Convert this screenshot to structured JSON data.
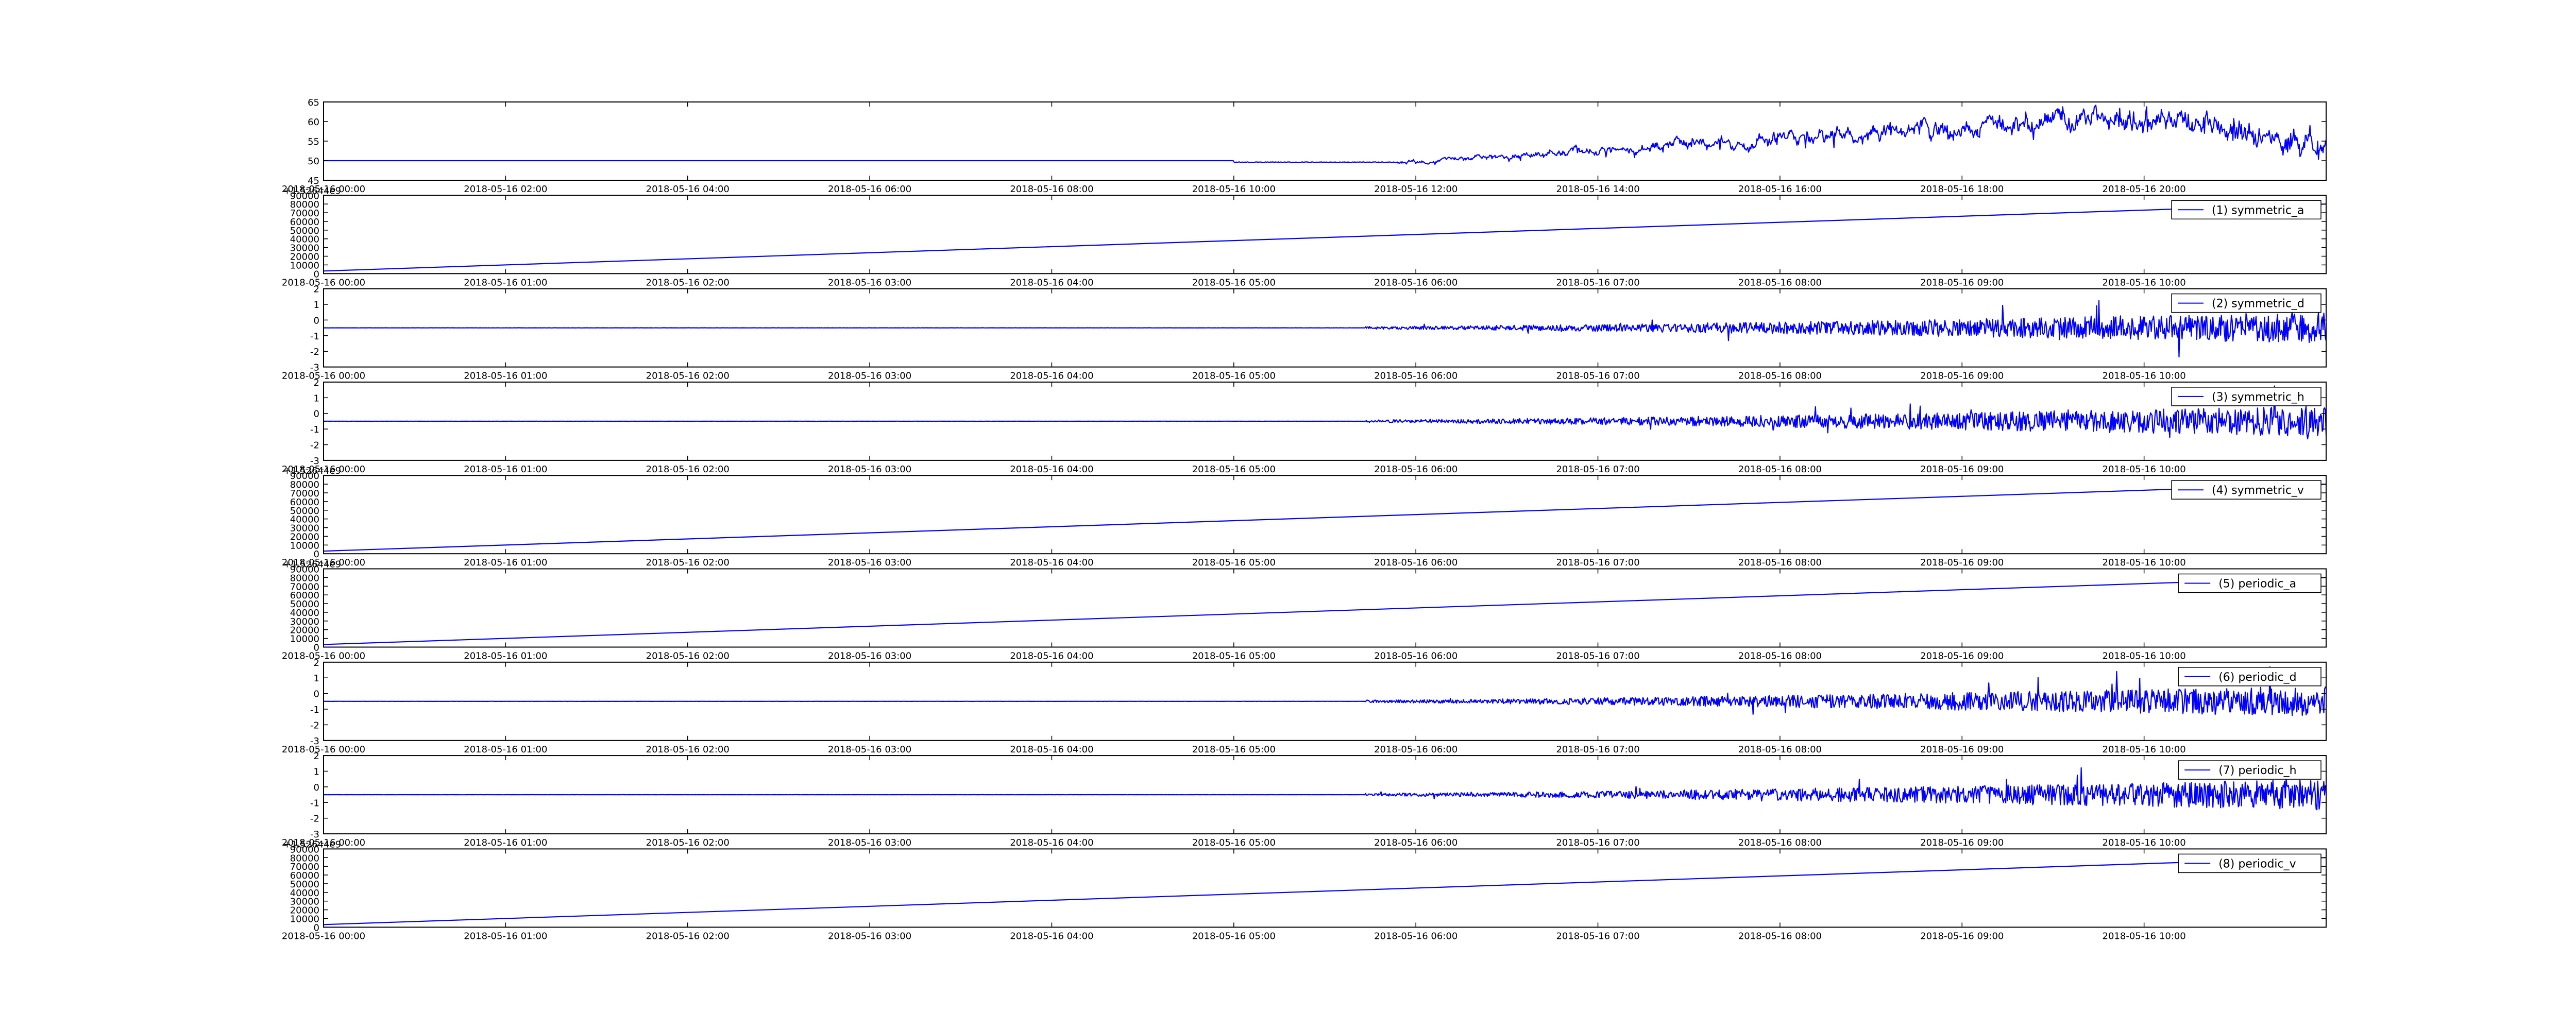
{
  "chart_data": [
    {
      "type": "line",
      "series": [
        {
          "kind": "temp_noise",
          "color": "#0000ff"
        }
      ],
      "x_ticks": [
        "2018-05-16 02:00",
        "2018-05-16 04:00",
        "2018-05-16 06:00",
        "2018-05-16 08:00",
        "2018-05-16 10:00",
        "2018-05-16 12:00",
        "2018-05-16 14:00",
        "2018-05-16 16:00",
        "2018-05-16 18:00",
        "2018-05-16 20:00"
      ],
      "x_tick_left": "2018-05-16 00:00",
      "xlim": [
        "2018-05-16 00:00",
        "2018-05-16 22:00"
      ],
      "y_ticks": [
        45,
        50,
        55,
        60,
        65
      ],
      "ylim": [
        45,
        65
      ],
      "offset_label": "",
      "legend": null,
      "grid": false
    },
    {
      "type": "line",
      "series": [
        {
          "name": "(1) symmetric_a",
          "kind": "linear",
          "values_from_to": [
            3000,
            80000
          ],
          "color": "#0000ff"
        }
      ],
      "x_ticks": [
        "2018-05-16 00:00",
        "2018-05-16 01:00",
        "2018-05-16 02:00",
        "2018-05-16 03:00",
        "2018-05-16 04:00",
        "2018-05-16 05:00",
        "2018-05-16 06:00",
        "2018-05-16 07:00",
        "2018-05-16 08:00",
        "2018-05-16 09:00",
        "2018-05-16 10:00"
      ],
      "xlim": [
        "2018-05-16 00:00",
        "2018-05-16 11:00"
      ],
      "y_ticks": [
        0,
        10000,
        20000,
        30000,
        40000,
        50000,
        60000,
        70000,
        80000,
        90000
      ],
      "ylim": [
        0,
        90000
      ],
      "offset_label": "+1.52644e9",
      "legend": "top-right",
      "grid": false
    },
    {
      "type": "line",
      "series": [
        {
          "name": "(2) symmetric_d",
          "kind": "noise",
          "color": "#0000ff"
        }
      ],
      "x_ticks": [
        "2018-05-16 00:00",
        "2018-05-16 01:00",
        "2018-05-16 02:00",
        "2018-05-16 03:00",
        "2018-05-16 04:00",
        "2018-05-16 05:00",
        "2018-05-16 06:00",
        "2018-05-16 07:00",
        "2018-05-16 08:00",
        "2018-05-16 09:00",
        "2018-05-16 10:00"
      ],
      "xlim": [
        "2018-05-16 00:00",
        "2018-05-16 11:00"
      ],
      "y_ticks": [
        -3,
        -2,
        -1,
        0,
        1,
        2
      ],
      "ylim": [
        -3,
        2
      ],
      "offset_label": "",
      "legend": "top-right",
      "grid": false
    },
    {
      "type": "line",
      "series": [
        {
          "name": "(3) symmetric_h",
          "kind": "noise",
          "color": "#0000ff"
        }
      ],
      "x_ticks": [
        "2018-05-16 00:00",
        "2018-05-16 01:00",
        "2018-05-16 02:00",
        "2018-05-16 03:00",
        "2018-05-16 04:00",
        "2018-05-16 05:00",
        "2018-05-16 06:00",
        "2018-05-16 07:00",
        "2018-05-16 08:00",
        "2018-05-16 09:00",
        "2018-05-16 10:00"
      ],
      "xlim": [
        "2018-05-16 00:00",
        "2018-05-16 11:00"
      ],
      "y_ticks": [
        -3,
        -2,
        -1,
        0,
        1,
        2
      ],
      "ylim": [
        -3,
        2
      ],
      "offset_label": "",
      "legend": "top-right",
      "grid": false
    },
    {
      "type": "line",
      "series": [
        {
          "name": "(4) symmetric_v",
          "kind": "linear",
          "values_from_to": [
            3000,
            80000
          ],
          "color": "#0000ff"
        }
      ],
      "x_ticks": [
        "2018-05-16 00:00",
        "2018-05-16 01:00",
        "2018-05-16 02:00",
        "2018-05-16 03:00",
        "2018-05-16 04:00",
        "2018-05-16 05:00",
        "2018-05-16 06:00",
        "2018-05-16 07:00",
        "2018-05-16 08:00",
        "2018-05-16 09:00",
        "2018-05-16 10:00"
      ],
      "xlim": [
        "2018-05-16 00:00",
        "2018-05-16 11:00"
      ],
      "y_ticks": [
        0,
        10000,
        20000,
        30000,
        40000,
        50000,
        60000,
        70000,
        80000,
        90000
      ],
      "ylim": [
        0,
        90000
      ],
      "offset_label": "+1.52644e9",
      "legend": "top-right",
      "grid": false
    },
    {
      "type": "line",
      "series": [
        {
          "name": "(5) periodic_a",
          "kind": "linear",
          "values_from_to": [
            3000,
            80000
          ],
          "color": "#0000ff"
        }
      ],
      "x_ticks": [
        "2018-05-16 00:00",
        "2018-05-16 01:00",
        "2018-05-16 02:00",
        "2018-05-16 03:00",
        "2018-05-16 04:00",
        "2018-05-16 05:00",
        "2018-05-16 06:00",
        "2018-05-16 07:00",
        "2018-05-16 08:00",
        "2018-05-16 09:00",
        "2018-05-16 10:00"
      ],
      "xlim": [
        "2018-05-16 00:00",
        "2018-05-16 11:00"
      ],
      "y_ticks": [
        0,
        10000,
        20000,
        30000,
        40000,
        50000,
        60000,
        70000,
        80000,
        90000
      ],
      "ylim": [
        0,
        90000
      ],
      "offset_label": "+1.52644e9",
      "legend": "top-right",
      "grid": false
    },
    {
      "type": "line",
      "series": [
        {
          "name": "(6) periodic_d",
          "kind": "noise",
          "color": "#0000ff"
        }
      ],
      "x_ticks": [
        "2018-05-16 00:00",
        "2018-05-16 01:00",
        "2018-05-16 02:00",
        "2018-05-16 03:00",
        "2018-05-16 04:00",
        "2018-05-16 05:00",
        "2018-05-16 06:00",
        "2018-05-16 07:00",
        "2018-05-16 08:00",
        "2018-05-16 09:00",
        "2018-05-16 10:00"
      ],
      "xlim": [
        "2018-05-16 00:00",
        "2018-05-16 11:00"
      ],
      "y_ticks": [
        -3,
        -2,
        -1,
        0,
        1,
        2
      ],
      "ylim": [
        -3,
        2
      ],
      "offset_label": "",
      "legend": "top-right",
      "grid": false
    },
    {
      "type": "line",
      "series": [
        {
          "name": "(7) periodic_h",
          "kind": "noise",
          "color": "#0000ff"
        }
      ],
      "x_ticks": [
        "2018-05-16 00:00",
        "2018-05-16 01:00",
        "2018-05-16 02:00",
        "2018-05-16 03:00",
        "2018-05-16 04:00",
        "2018-05-16 05:00",
        "2018-05-16 06:00",
        "2018-05-16 07:00",
        "2018-05-16 08:00",
        "2018-05-16 09:00",
        "2018-05-16 10:00"
      ],
      "xlim": [
        "2018-05-16 00:00",
        "2018-05-16 11:00"
      ],
      "y_ticks": [
        -3,
        -2,
        -1,
        0,
        1,
        2
      ],
      "ylim": [
        -3,
        2
      ],
      "offset_label": "",
      "legend": "top-right",
      "grid": false
    },
    {
      "type": "line",
      "series": [
        {
          "name": "(8) periodic_v",
          "kind": "linear",
          "values_from_to": [
            3000,
            80000
          ],
          "color": "#0000ff"
        }
      ],
      "x_ticks": [
        "2018-05-16 00:00",
        "2018-05-16 01:00",
        "2018-05-16 02:00",
        "2018-05-16 03:00",
        "2018-05-16 04:00",
        "2018-05-16 05:00",
        "2018-05-16 06:00",
        "2018-05-16 07:00",
        "2018-05-16 08:00",
        "2018-05-16 09:00",
        "2018-05-16 10:00"
      ],
      "xlim": [
        "2018-05-16 00:00",
        "2018-05-16 11:00"
      ],
      "y_ticks": [
        0,
        10000,
        20000,
        30000,
        40000,
        50000,
        60000,
        70000,
        80000,
        90000
      ],
      "ylim": [
        0,
        90000
      ],
      "offset_label": "+1.52644e9",
      "legend": "top-right",
      "grid": false
    }
  ]
}
